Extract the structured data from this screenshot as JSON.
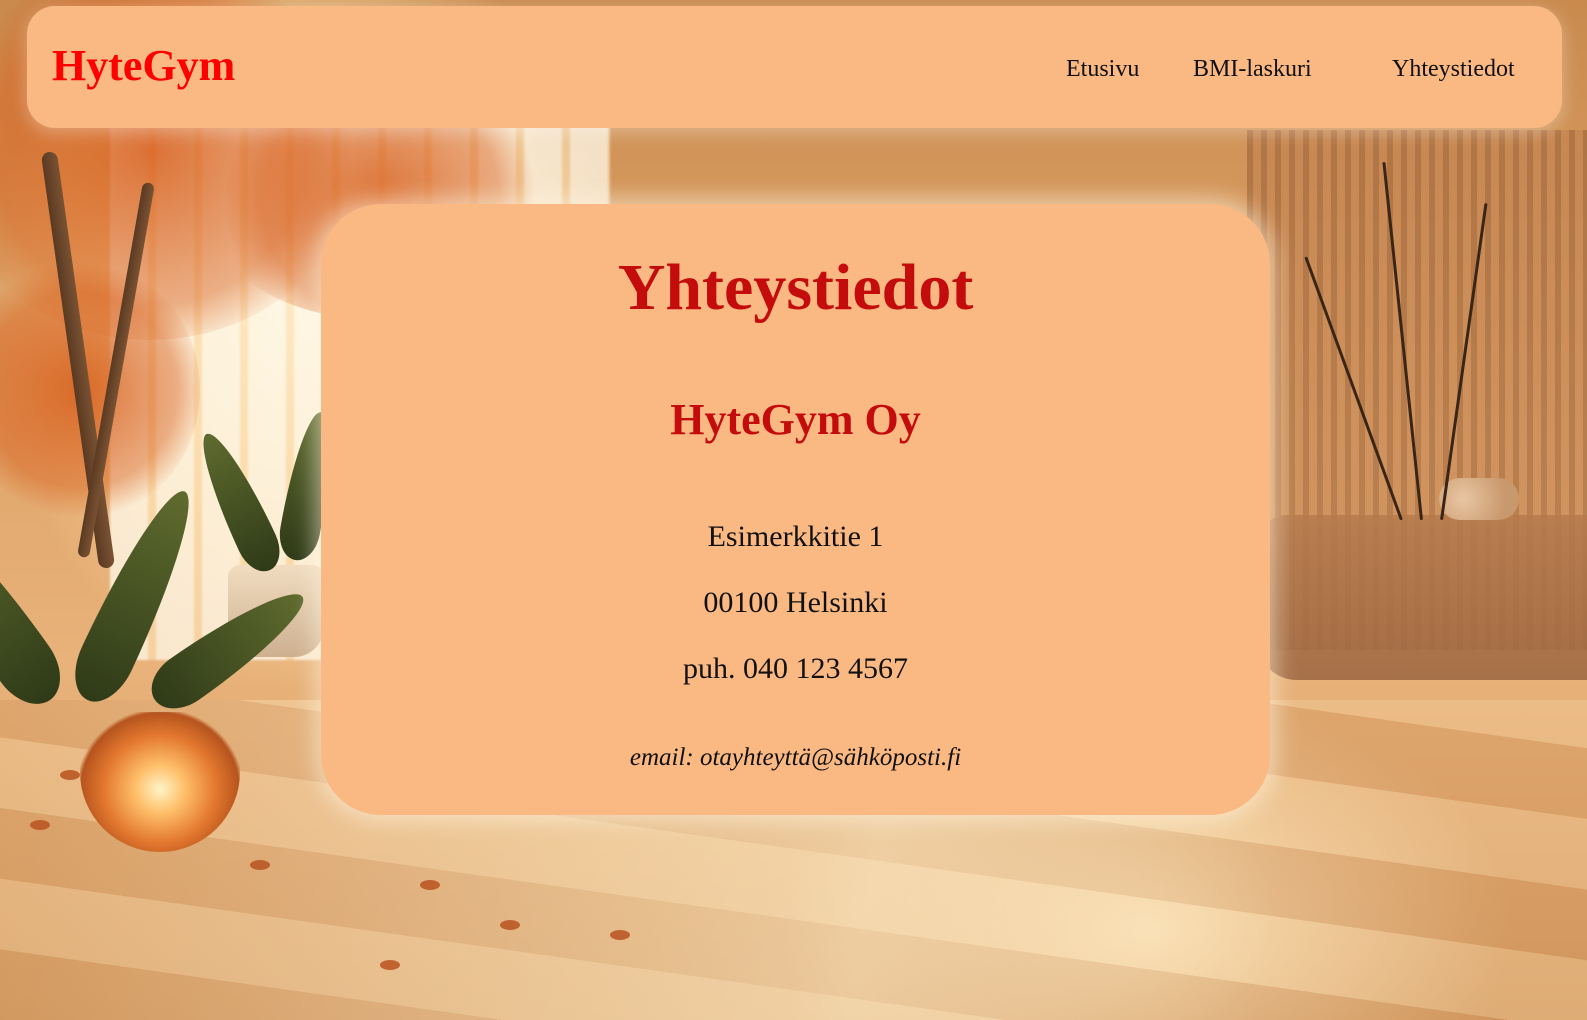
{
  "navbar": {
    "brand": "HyteGym",
    "links": [
      {
        "label": "Etusivu"
      },
      {
        "label": "BMI-laskuri"
      },
      {
        "label": "Yhteystiedot"
      }
    ]
  },
  "contact": {
    "title": "Yhteystiedot",
    "company": "HyteGym Oy",
    "street": "Esimerkkitie 1",
    "city": "00100 Helsinki",
    "phone": "puh. 040 123 4567",
    "email": "email: otayhteyttä@sähköposti.fi"
  },
  "colors": {
    "panel": "#fab883",
    "brand_red": "#ff0000",
    "heading_red": "#c40c0c",
    "text": "#111111"
  }
}
